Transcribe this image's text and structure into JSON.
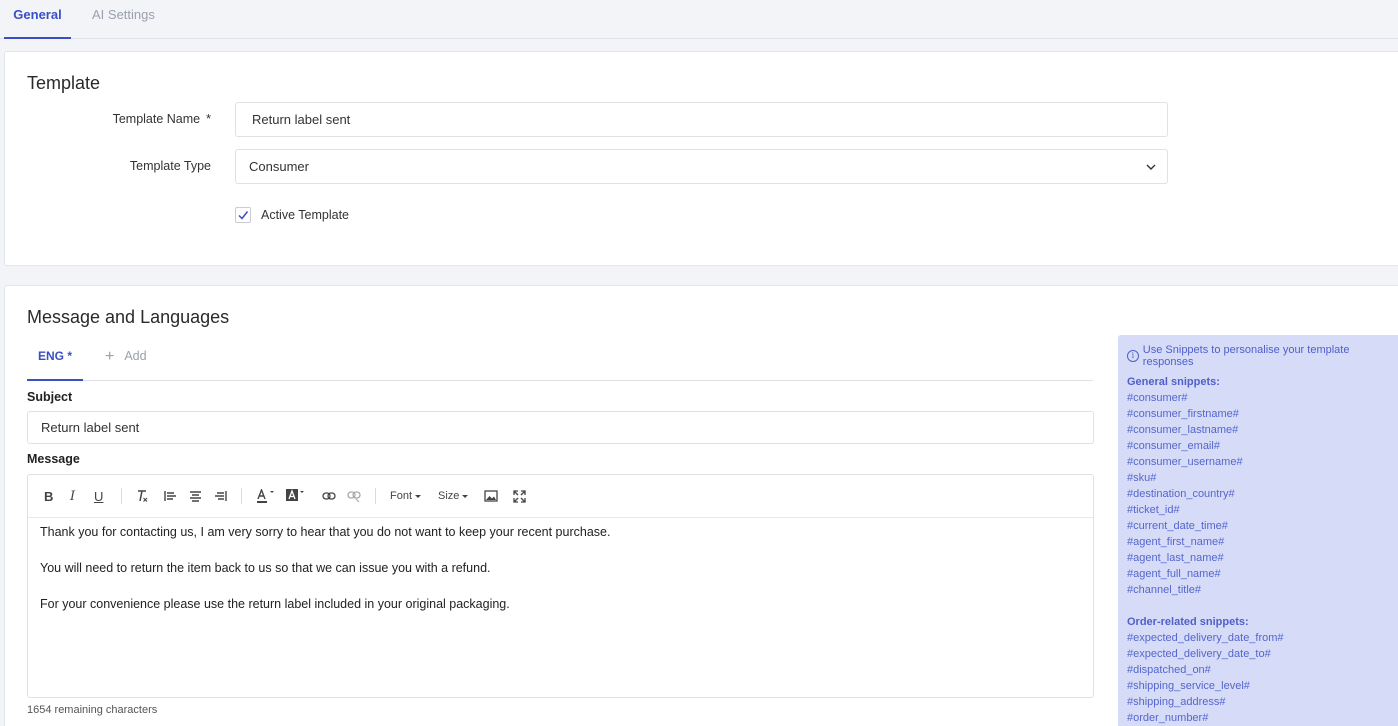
{
  "tabs": {
    "general": "General",
    "ai_settings": "AI Settings"
  },
  "template": {
    "heading": "Template",
    "name_label": "Template Name",
    "required_mark": "*",
    "name_value": "Return label sent",
    "type_label": "Template Type",
    "type_value": "Consumer",
    "active_label": "Active Template",
    "active_checked": true
  },
  "message": {
    "heading": "Message and Languages",
    "lang_tab": "ENG *",
    "add_label": "Add",
    "subject_label": "Subject",
    "subject_value": "Return label sent",
    "message_label": "Message",
    "toolbar": {
      "font": "Font",
      "size": "Size"
    },
    "body": [
      "Thank you for contacting us, I am very sorry to hear that you do not want to keep your recent purchase.",
      "You will need to return the item back to us so that we can issue you with a refund.",
      "For your convenience please use the return label included in your original packaging."
    ],
    "remaining": "1654 remaining characters"
  },
  "snippets": {
    "info": "Use Snippets to personalise your template responses",
    "general_heading": "General snippets:",
    "general": [
      "#consumer#",
      "#consumer_firstname#",
      "#consumer_lastname#",
      "#consumer_email#",
      "#consumer_username#",
      "#sku#",
      "#destination_country#",
      "#ticket_id#",
      "#current_date_time#",
      "#agent_first_name#",
      "#agent_last_name#",
      "#agent_full_name#",
      "#channel_title#"
    ],
    "order_heading": "Order-related snippets:",
    "order": [
      "#expected_delivery_date_from#",
      "#expected_delivery_date_to#",
      "#dispatched_on#",
      "#shipping_service_level#",
      "#shipping_address#",
      "#order_number#"
    ]
  },
  "colors": {
    "accent": "#3a4fc4",
    "snippet_bg": "#d6dcf8",
    "snippet_text": "#5566cc"
  }
}
